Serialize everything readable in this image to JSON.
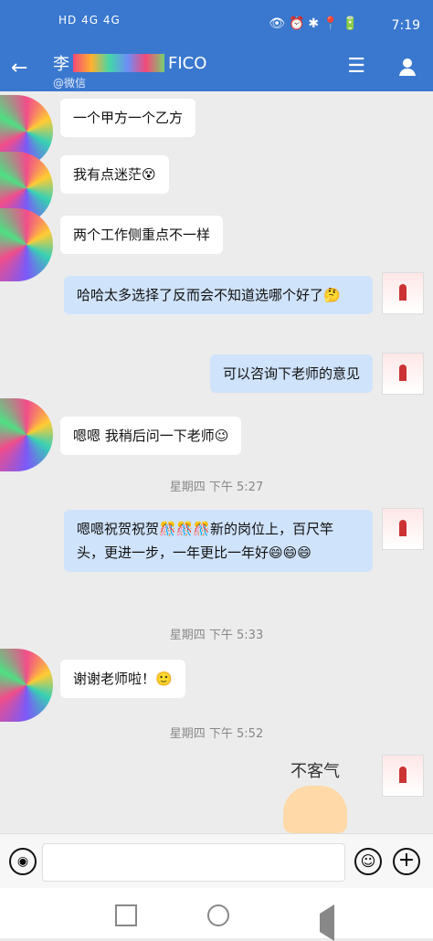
{
  "status": {
    "left_text": "HD 4G 4G",
    "right_time": "7:19"
  },
  "header": {
    "contact_name": "李",
    "contact_suffix": "FICO",
    "subtitle": "@微信"
  },
  "messages": [
    {
      "side": "in",
      "text": "一个甲方一个乙方"
    },
    {
      "side": "in",
      "text": "我有点迷茫😵"
    },
    {
      "side": "in",
      "text": "两个工作侧重点不一样"
    },
    {
      "side": "out",
      "text": "哈哈太多选择了反而会不知道选哪个好了🤔"
    },
    {
      "side": "out",
      "text": "可以咨询下老师的意见"
    },
    {
      "side": "in",
      "text": "嗯嗯 我稍后问一下老师😉"
    },
    {
      "side": "time",
      "text": "星期四 下午 5:27"
    },
    {
      "side": "out",
      "text": "嗯嗯祝贺祝贺🎊🎊🎊新的岗位上，百尺竿头，更进一步，一年更比一年好😄😄😄"
    },
    {
      "side": "time",
      "text": "星期四 下午 5:33"
    },
    {
      "side": "in",
      "text": "谢谢老师啦！🙂"
    },
    {
      "side": "time",
      "text": "星期四 下午 5:52"
    }
  ],
  "sticker_text": "不客气"
}
